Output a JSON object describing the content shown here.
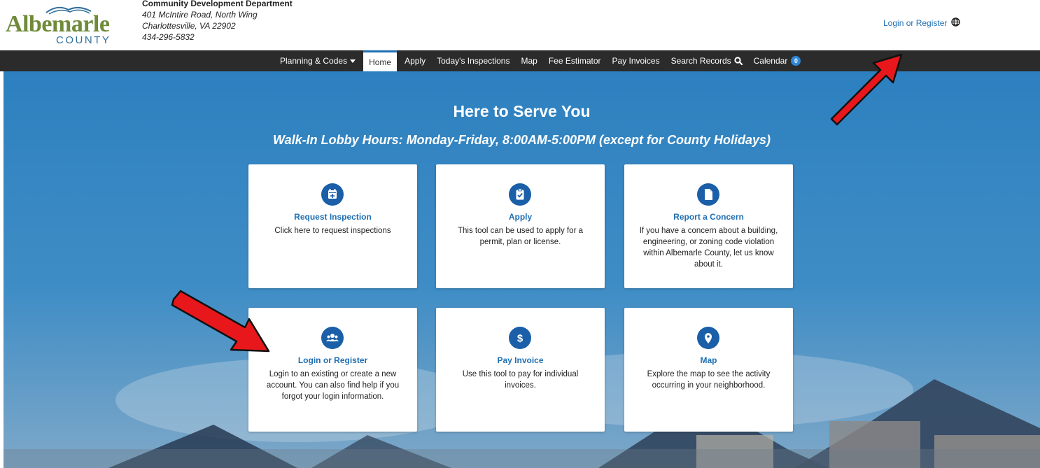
{
  "header": {
    "logo_word": "Albemarle",
    "logo_sub": "COUNTY",
    "dept_name": "Community Development Department",
    "address1": "401 McIntire Road, North Wing",
    "address2": "Charlottesville, VA 22902",
    "phone": "434-296-5832",
    "login_link": "Login or Register",
    "globe_icon": "globe-icon"
  },
  "nav": {
    "planning": "Planning & Codes",
    "home": "Home",
    "apply": "Apply",
    "inspections": "Today's Inspections",
    "map": "Map",
    "fee": "Fee Estimator",
    "invoices": "Pay Invoices",
    "search": "Search Records",
    "calendar": "Calendar",
    "calendar_count": "0"
  },
  "hero": {
    "title": "Here to Serve You",
    "subtitle": "Walk-In Lobby Hours: Monday-Friday, 8:00AM-5:00PM (except for County Holidays)"
  },
  "cards": [
    {
      "title": "Request Inspection",
      "desc": "Click here to request inspections",
      "icon": "calendar-plus-icon"
    },
    {
      "title": "Apply",
      "desc": "This tool can be used to apply for a permit, plan or license.",
      "icon": "clipboard-check-icon"
    },
    {
      "title": "Report a Concern",
      "desc": "If you have a concern about a building, engineering, or zoning code violation within Albemarle County, let us know about it.",
      "icon": "document-icon"
    },
    {
      "title": "Login or Register",
      "desc": "Login to an existing or create a new account. You can also find help if you forgot your login information.",
      "icon": "users-icon"
    },
    {
      "title": "Pay Invoice",
      "desc": "Use this tool to pay for individual invoices.",
      "icon": "dollar-icon"
    },
    {
      "title": "Map",
      "desc": "Explore the map to see the activity occurring in your neighborhood.",
      "icon": "map-pin-icon"
    }
  ],
  "colors": {
    "brand_green": "#6f8b3a",
    "link_blue": "#1f6fb3",
    "icon_blue": "#1a5fa8",
    "navbar": "#2b2b2b",
    "arrow_red": "#e8171b"
  }
}
